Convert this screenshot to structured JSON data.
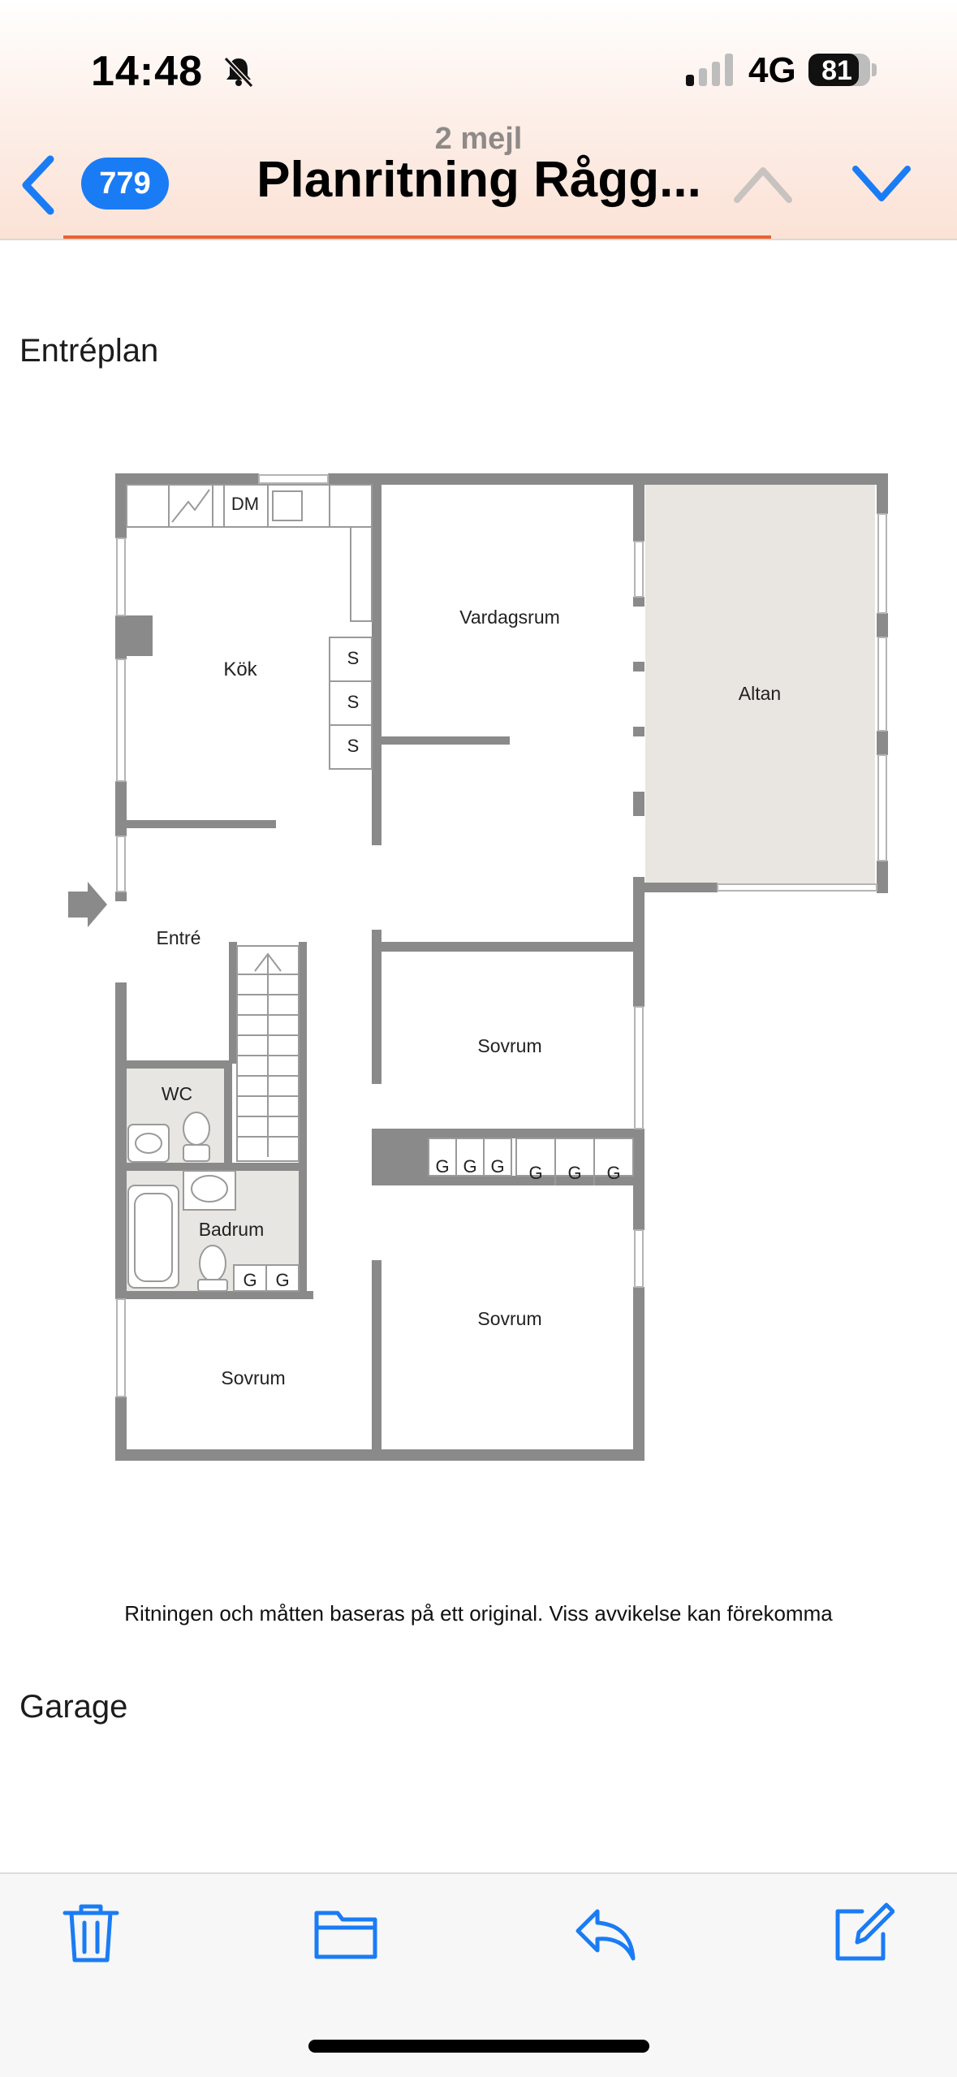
{
  "status_bar": {
    "time": "14:48",
    "network": "4G",
    "battery": "81",
    "battery_level": 0.81,
    "signal_bars_active": 1
  },
  "nav": {
    "unread_count": "779",
    "subtitle": "2 mejl",
    "title": "Planritning Rågg..."
  },
  "content": {
    "section1_title": "Entréplan",
    "rooms": {
      "dm": "DM",
      "kok": "Kök",
      "vardagsrum": "Vardagsrum",
      "altan": "Altan",
      "entre": "Entré",
      "wc": "WC",
      "badrum": "Badrum",
      "sovrum_1": "Sovrum",
      "sovrum_2": "Sovrum",
      "sovrum_3": "Sovrum",
      "s1": "S",
      "s2": "S",
      "s3": "S",
      "g1": "G",
      "g2": "G",
      "g3": "G",
      "g4": "G",
      "g5": "G",
      "g6": "G",
      "g7": "G",
      "g8": "G"
    },
    "note": "Ritningen och måtten baseras på ett original. Viss avvikelse kan förekomma",
    "section2_title": "Garage"
  },
  "toolbar": {
    "icons": [
      "trash-icon",
      "folder-icon",
      "reply-icon",
      "compose-icon"
    ]
  },
  "colors": {
    "accent_blue": "#1a7cf5",
    "progress_orange": "#e8622f",
    "wall_gray": "#8a8a8a",
    "altan_fill": "#e9e6e2"
  }
}
